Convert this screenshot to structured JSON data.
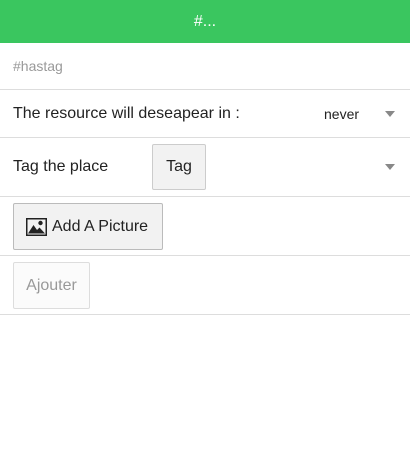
{
  "header": {
    "title": "#..."
  },
  "form": {
    "hashtag": {
      "placeholder": "#hastag",
      "value": ""
    },
    "expire": {
      "label": "The resource will deseapear in :",
      "selected": "never"
    },
    "tag": {
      "label": "Tag the place",
      "button_label": "Tag"
    },
    "picture": {
      "button_label": "Add A Picture",
      "icon": "image-icon"
    },
    "submit": {
      "button_label": "Ajouter"
    }
  },
  "colors": {
    "header_bg": "#3ac65f",
    "header_text": "#ffffff"
  }
}
